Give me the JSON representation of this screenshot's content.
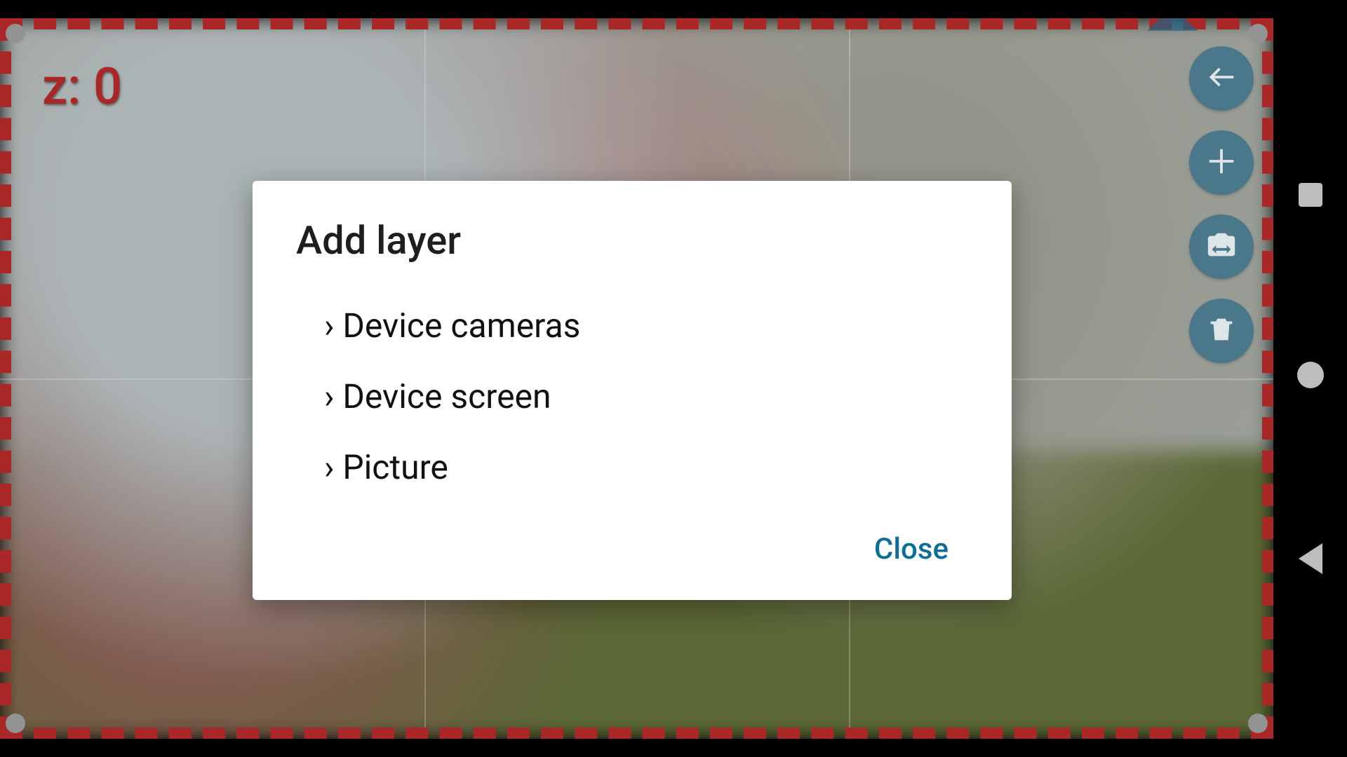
{
  "viewport": {
    "z_label": "z: 0"
  },
  "tools": {
    "items": [
      {
        "name": "undo"
      },
      {
        "name": "add"
      },
      {
        "name": "swap-camera"
      },
      {
        "name": "delete"
      }
    ]
  },
  "dialog": {
    "title": "Add layer",
    "options": [
      "Device cameras",
      "Device screen",
      "Picture"
    ],
    "close_label": "Close"
  },
  "navbar": {
    "buttons": [
      "recent",
      "home",
      "back"
    ]
  },
  "colors": {
    "accent": "#0f6e96",
    "selection": "#b42a2a",
    "fab": "rgba(35,104,140,.65)"
  }
}
